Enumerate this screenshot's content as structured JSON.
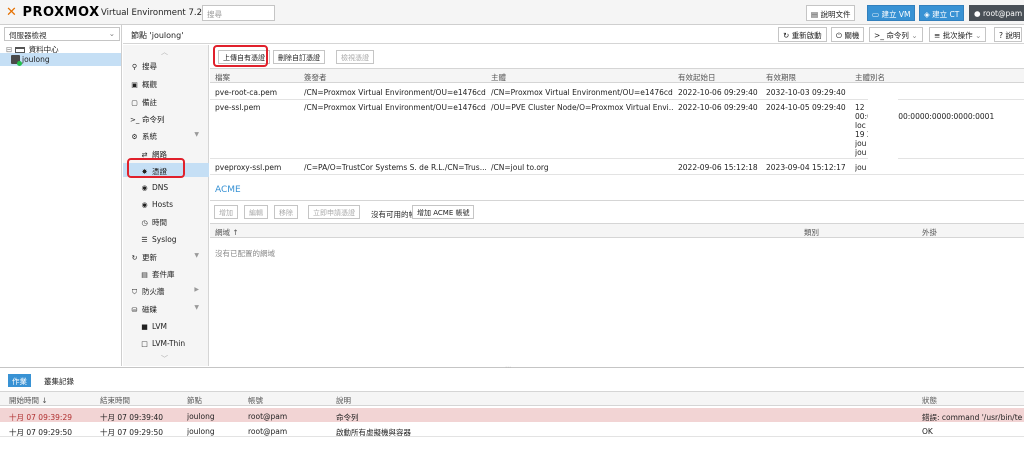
{
  "topbar": {
    "logo_text": "PROXMOX",
    "version": "Virtual Environment 7.2-3",
    "search_placeholder": "搜尋",
    "docs_label": "說明文件",
    "create_vm_label": "建立 VM",
    "create_ct_label": "建立 CT",
    "user_label": "root@pam"
  },
  "left": {
    "view_select": "伺服器檢視",
    "datacenter": "資料中心",
    "node": "joulong"
  },
  "content_header": {
    "title": "節點 'joulong'",
    "reboot": "重新啟動",
    "shutdown": "關機",
    "shell": "命令列",
    "bulk": "批次操作",
    "help": "說明"
  },
  "nav": {
    "items": [
      {
        "label": "搜尋",
        "icon": "search-icon"
      },
      {
        "label": "概觀",
        "icon": "summary-icon"
      },
      {
        "label": "備註",
        "icon": "notes-icon"
      },
      {
        "label": "命令列",
        "icon": "shell-icon"
      },
      {
        "label": "系統",
        "icon": "gears-icon"
      },
      {
        "label": "網路",
        "icon": "network-icon"
      },
      {
        "label": "憑證",
        "icon": "certificate-icon"
      },
      {
        "label": "DNS",
        "icon": "globe-icon"
      },
      {
        "label": "Hosts",
        "icon": "globe-icon"
      },
      {
        "label": "時間",
        "icon": "clock-icon"
      },
      {
        "label": "Syslog",
        "icon": "list-icon"
      },
      {
        "label": "更新",
        "icon": "refresh-icon"
      },
      {
        "label": "套件庫",
        "icon": "repository-icon"
      },
      {
        "label": "防火牆",
        "icon": "shield-icon"
      },
      {
        "label": "磁碟",
        "icon": "disk-icon"
      },
      {
        "label": "LVM",
        "icon": "square-icon"
      },
      {
        "label": "LVM-Thin",
        "icon": "square-outline-icon"
      }
    ]
  },
  "certs": {
    "upload_btn": "上傳自有憑證",
    "delete_btn": "刪除自訂憑證",
    "view_btn": "檢視憑證",
    "columns": [
      "檔案",
      "簽發者",
      "主體",
      "有效起始日",
      "有效期限",
      "主體別名"
    ],
    "rows": [
      {
        "file": "pve-root-ca.pem",
        "issuer": "/CN=Proxmox Virtual Environment/OU=e1476cd...",
        "subject": "/CN=Proxmox Virtual Environment/OU=e1476cd...",
        "from": "2022-10-06 09:29:40",
        "to": "2032-10-03 09:29:40",
        "san": ""
      },
      {
        "file": "pve-ssl.pem",
        "issuer": "/CN=Proxmox Virtual Environment/OU=e1476cd...",
        "subject": "/OU=PVE Cluster Node/O=Proxmox Virtual Envi...",
        "from": "2022-10-06 09:29:40",
        "to": "2024-10-05 09:29:40",
        "san_lines": [
          "12",
          "00:0000:0000:0000:0000:0000:0001",
          "loc",
          "19                    2",
          "jou",
          "jou                 o.org"
        ]
      },
      {
        "file": "pveproxy-ssl.pem",
        "issuer": "/C=PA/O=TrustCor Systems S. de R.L./CN=Trus...",
        "subject": "/CN=joul              to.org",
        "from": "2022-09-06 15:12:18",
        "to": "2023-09-04 15:12:17",
        "san": "jou              o.org"
      }
    ]
  },
  "acme": {
    "title": "ACME",
    "add_btn": "增加",
    "edit_btn": "編輯",
    "remove_btn": "移除",
    "order_btn": "立即申請憑證",
    "no_account": "沒有可用的帳戶。",
    "add_account_btn": "增加 ACME 帳號",
    "columns": [
      "網域 ↑",
      "類別",
      "外掛"
    ],
    "empty_text": "沒有已配置的網域"
  },
  "bottom": {
    "tab_tasks": "作業",
    "tab_log": "叢集記錄",
    "columns": [
      "開始時間 ↓",
      "結束時間",
      "節點",
      "帳號",
      "說明",
      "狀態"
    ],
    "rows": [
      {
        "start": "十月 07 09:39:29",
        "end": "十月 07 09:39:40",
        "node": "joulong",
        "user": "root@pam",
        "desc": "命令列",
        "status": "錯誤: command '/usr/bin/ter...",
        "error": true
      },
      {
        "start": "十月 07 09:29:50",
        "end": "十月 07 09:29:50",
        "node": "joulong",
        "user": "root@pam",
        "desc": "啟動所有虛擬機與容器",
        "status": "OK",
        "error": false
      }
    ]
  }
}
